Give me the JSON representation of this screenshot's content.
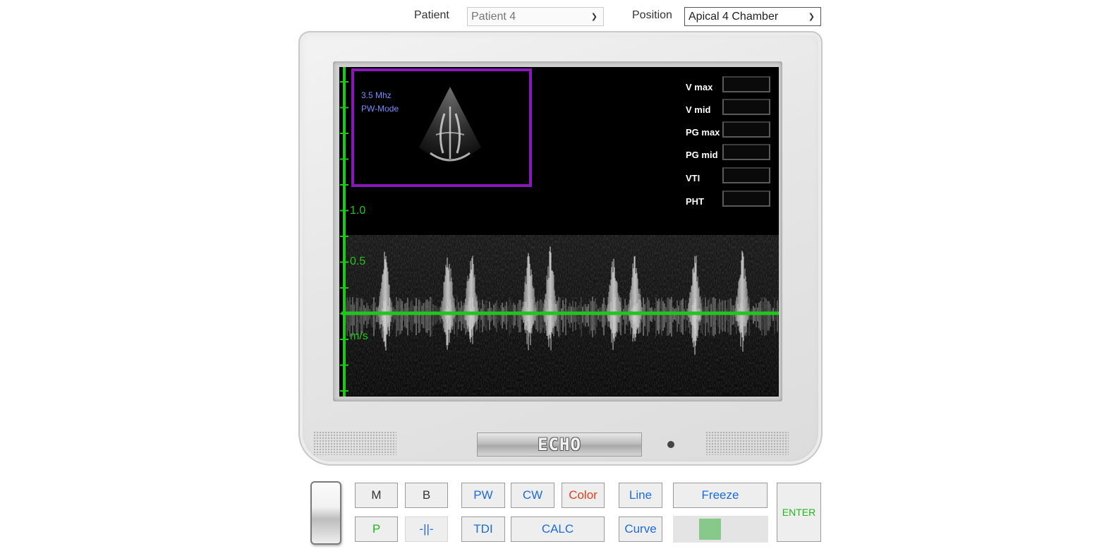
{
  "top_bar": {
    "patient_label": "Patient",
    "patient_value": "Patient 4",
    "position_label": "Position",
    "position_value": "Apical 4 Chamber"
  },
  "screen": {
    "frequency": "3.5 Mhz",
    "mode": "PW-Mode",
    "axis": {
      "upper": "1.0",
      "mid": "0.5",
      "unit": "m/s"
    },
    "measurements": [
      {
        "label": "V max",
        "value": ""
      },
      {
        "label": "V mid",
        "value": ""
      },
      {
        "label": "PG max",
        "value": ""
      },
      {
        "label": "PG mid",
        "value": ""
      },
      {
        "label": "VTI",
        "value": ""
      },
      {
        "label": "PHT",
        "value": ""
      }
    ]
  },
  "monitor": {
    "brand": "ECHO"
  },
  "controls": {
    "m": "M",
    "b": "B",
    "pw": "PW",
    "cw": "CW",
    "color": "Color",
    "line": "Line",
    "freeze": "Freeze",
    "enter": "ENTER",
    "p": "P",
    "split": "-||-",
    "tdi": "TDI",
    "calc": "CALC",
    "curve": "Curve"
  },
  "colors": {
    "axis_green": "#22c41e",
    "thumb_border": "#8a18b6",
    "info_text": "#7a8cff",
    "button_blue": "#1c6bd8",
    "button_green": "#20b81b",
    "button_red": "#e0401a",
    "slider_knob": "#87c98b"
  },
  "slider": {
    "position": 0.35
  }
}
